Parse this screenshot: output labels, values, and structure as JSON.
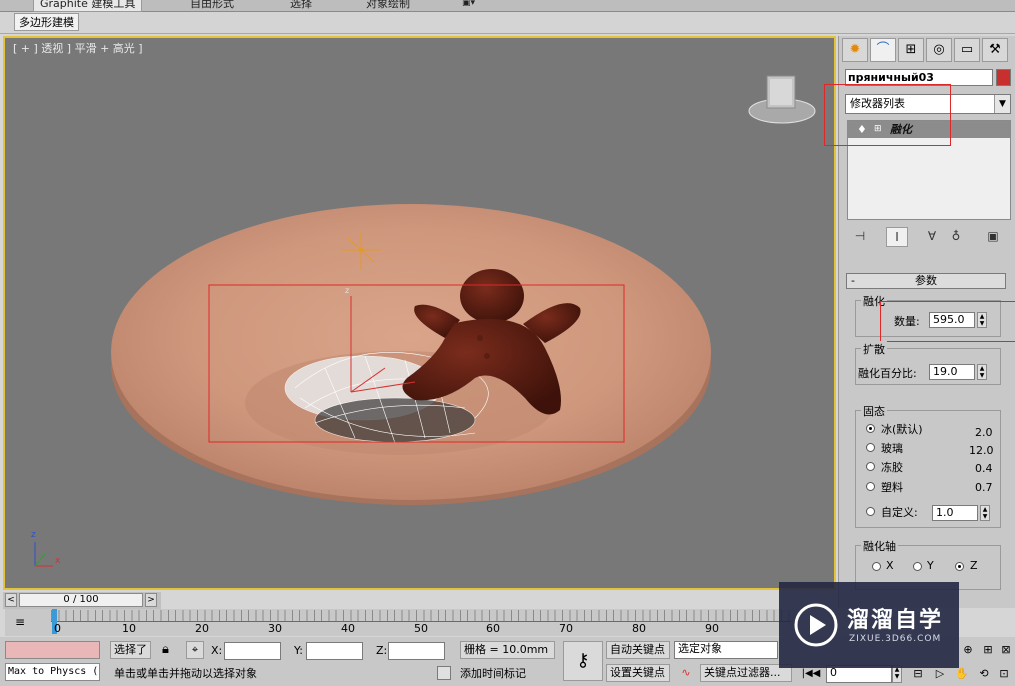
{
  "ribbon": {
    "tabs": [
      {
        "label": "Graphite 建模工具",
        "active": true
      },
      {
        "label": "自由形式",
        "active": false
      },
      {
        "label": "选择",
        "active": false
      },
      {
        "label": "对象绘制",
        "active": false
      }
    ],
    "subtab": "多边形建模"
  },
  "viewport": {
    "label": "[ + ] 透视 ] 平滑 + 高光 ]",
    "axis_x": "x",
    "axis_z": "z",
    "gizmo_z": "z"
  },
  "command_panel": {
    "object_name": "пряничный03",
    "object_color": "#c83030",
    "modifier_list": "修改器列表",
    "stack_item": "融化",
    "rollout_title": "参数",
    "melt_group": "融化",
    "amount_label": "数量:",
    "amount_value": "595.0",
    "spread_group": "扩散",
    "spread_label": "融化百分比:",
    "spread_value": "19.0",
    "solidity_group": "固态",
    "solidity_options": [
      {
        "label": "冰(默认)",
        "value": "2.0",
        "selected": true
      },
      {
        "label": "玻璃",
        "value": "12.0",
        "selected": false
      },
      {
        "label": "冻胶",
        "value": "0.4",
        "selected": false
      },
      {
        "label": "塑料",
        "value": "0.7",
        "selected": false
      }
    ],
    "custom_label": "自定义:",
    "custom_value": "1.0",
    "axis_group": "融化轴",
    "axis_options": [
      {
        "label": "X",
        "selected": false
      },
      {
        "label": "Y",
        "selected": false
      },
      {
        "label": "Z",
        "selected": true
      }
    ]
  },
  "timeline": {
    "frame_readout": "0 / 100",
    "ticks": [
      "0",
      "10",
      "20",
      "30",
      "40",
      "50",
      "60",
      "70",
      "80",
      "90"
    ]
  },
  "status": {
    "maxscript": "Max to Physcs (",
    "selection": "选择了",
    "x_label": "X:",
    "y_label": "Y:",
    "z_label": "Z:",
    "grid": "栅格 = 10.0mm",
    "prompt": "单击或单击并拖动以选择对象",
    "add_time_tag": "添加时间标记",
    "auto_key": "自动关键点",
    "set_key": "设置关键点",
    "selected_object": "选定对象",
    "key_filters": "关键点过滤器...",
    "frame_value": "0"
  },
  "watermark": {
    "brand": "溜溜自学",
    "url": "ZIXUE.3D66.COM"
  }
}
